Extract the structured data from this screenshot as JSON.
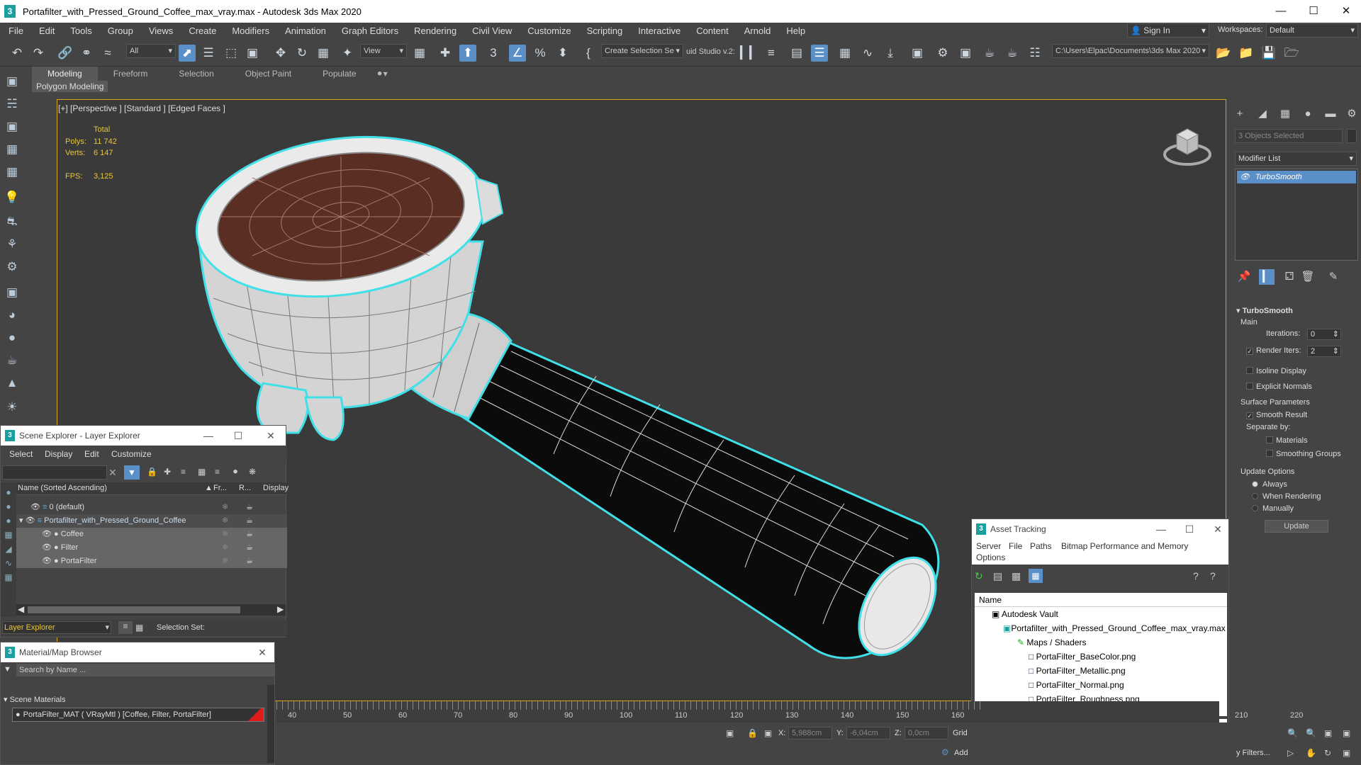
{
  "window": {
    "title": "Portafilter_with_Pressed_Ground_Coffee_max_vray.max - Autodesk 3ds Max 2020",
    "app_letter": "3"
  },
  "menu": [
    "File",
    "Edit",
    "Tools",
    "Group",
    "Views",
    "Create",
    "Modifiers",
    "Animation",
    "Graph Editors",
    "Rendering",
    "Civil View",
    "Customize",
    "Scripting",
    "Interactive",
    "Content",
    "Arnold",
    "Help"
  ],
  "account": {
    "sign_in": "Sign In",
    "workspaces_label": "Workspaces:",
    "workspace_value": "Default"
  },
  "toolbar": {
    "filter_value": "All",
    "ref_coord": "View",
    "named_selection": "Create Selection Se",
    "studio_label": "uid Studio v.2:",
    "project_path": "C:\\Users\\Elpac\\Documents\\3ds Max 2020"
  },
  "ribbon": {
    "tabs": [
      "Modeling",
      "Freeform",
      "Selection",
      "Object Paint",
      "Populate"
    ],
    "active_tab": "Modeling",
    "sub": "Polygon Modeling"
  },
  "viewport": {
    "label": "[+] [Perspective ] [Standard ] [Edged Faces ]",
    "stats_total": "Total",
    "polys_label": "Polys:",
    "polys_value": "11 742",
    "verts_label": "Verts:",
    "verts_value": "6 147",
    "fps_label": "FPS:",
    "fps_value": "3,125"
  },
  "command_panel": {
    "selection_field": "3 Objects Selected",
    "modifier_list": "Modifier List",
    "stack_item": "TurboSmooth",
    "rollout_title": "TurboSmooth",
    "main_label": "Main",
    "iterations_label": "Iterations:",
    "iterations_value": "0",
    "render_iters_label": "Render Iters:",
    "render_iters_value": "2",
    "isoline_label": "Isoline Display",
    "explicit_label": "Explicit Normals",
    "surface_label": "Surface Parameters",
    "smooth_result_label": "Smooth Result",
    "separate_label": "Separate by:",
    "materials_label": "Materials",
    "smoothing_label": "Smoothing Groups",
    "update_options_label": "Update Options",
    "always_label": "Always",
    "when_rendering_label": "When Rendering",
    "manually_label": "Manually",
    "update_button": "Update"
  },
  "scene_explorer": {
    "title": "Scene Explorer - Layer Explorer",
    "menu": [
      "Select",
      "Display",
      "Edit",
      "Customize"
    ],
    "col_name": "Name (Sorted Ascending)",
    "col_fr": "Fr...",
    "col_r": "R...",
    "col_display": "Display",
    "rows": [
      {
        "name": "0 (default)",
        "level": 0
      },
      {
        "name": "Portafilter_with_Pressed_Ground_Coffee",
        "level": 0
      },
      {
        "name": "Coffee",
        "level": 1
      },
      {
        "name": "Filter",
        "level": 1
      },
      {
        "name": "PortaFilter",
        "level": 1
      }
    ],
    "footer_layer": "Layer Explorer",
    "footer_selset": "Selection Set:"
  },
  "material_browser": {
    "title": "Material/Map Browser",
    "search_placeholder": "Search by Name ...",
    "section": "Scene Materials",
    "item": "PortaFilter_MAT  ( VRayMtl )  [Coffee, Filter, PortaFilter]"
  },
  "asset_tracking": {
    "title": "Asset Tracking",
    "menu": [
      "Server",
      "File",
      "Paths",
      "Bitmap Performance and Memory"
    ],
    "menu2": "Options",
    "col_name": "Name",
    "rows": [
      {
        "name": "Autodesk Vault",
        "level": 0
      },
      {
        "name": "Portafilter_with_Pressed_Ground_Coffee_max_vray.max",
        "level": 1
      },
      {
        "name": "Maps / Shaders",
        "level": 2
      },
      {
        "name": "PortaFilter_BaseColor.png",
        "level": 3
      },
      {
        "name": "PortaFilter_Metallic.png",
        "level": 3
      },
      {
        "name": "PortaFilter_Normal.png",
        "level": 3
      },
      {
        "name": "PortaFilter_Roughness.png",
        "level": 3
      }
    ]
  },
  "timeline": {
    "ticks": [
      "40",
      "50",
      "60",
      "70",
      "80",
      "90",
      "100",
      "110",
      "120",
      "130",
      "140",
      "150",
      "160",
      "210",
      "220"
    ]
  },
  "status": {
    "x_label": "X:",
    "x_value": "5,988cm",
    "y_label": "Y:",
    "y_value": "-6,04cm",
    "z_label": "Z:",
    "z_value": "0,0cm",
    "grid_label": "Grid",
    "add_label": "Add",
    "filters_label": "y Filters..."
  },
  "colors": {
    "accent": "#5b8fc8",
    "viewport_border": "#d7a318",
    "selection_outline": "#40e0e8",
    "stats": "#e8c53b"
  }
}
